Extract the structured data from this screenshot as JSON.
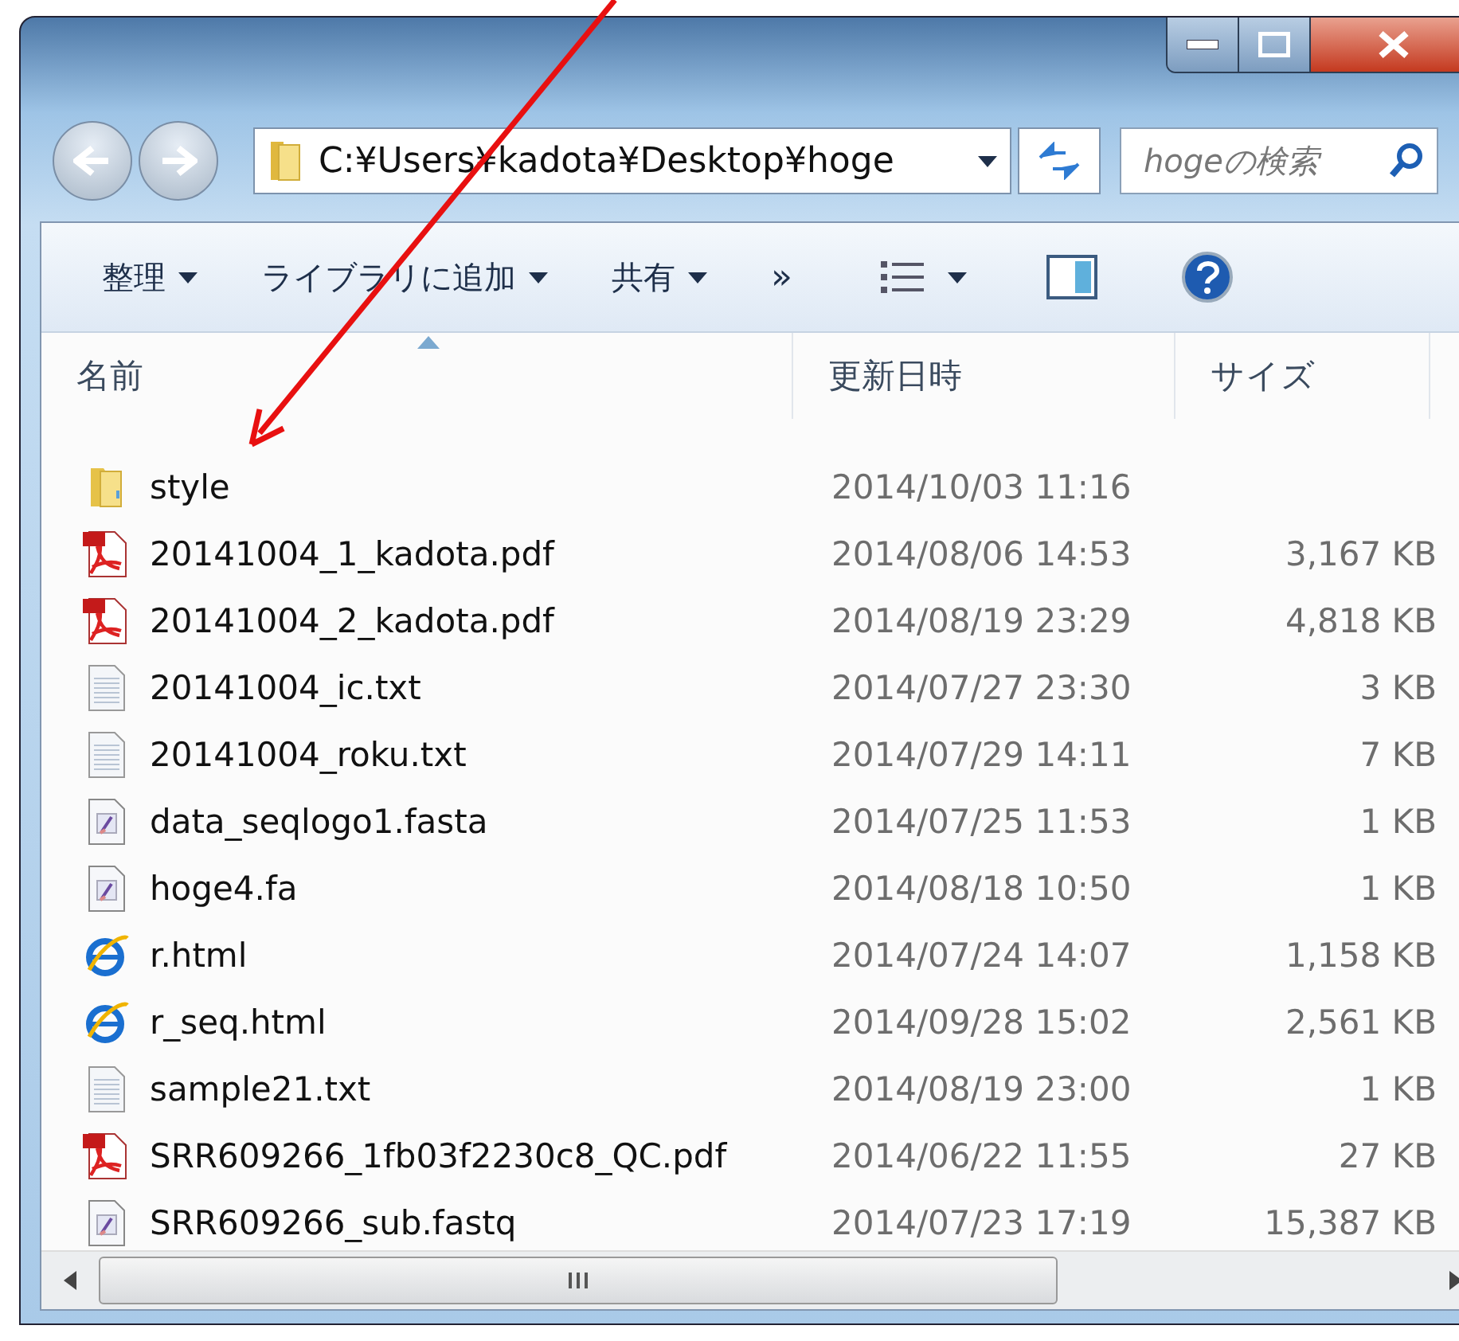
{
  "address_bar": {
    "path": "C:¥Users¥kadota¥Desktop¥hoge"
  },
  "search": {
    "placeholder": "hogeの検索"
  },
  "toolbar": {
    "items": [
      {
        "kind": "menu",
        "label": "整理"
      },
      {
        "kind": "menu",
        "label": "ライブラリに追加"
      },
      {
        "kind": "menu",
        "label": "共有"
      },
      {
        "kind": "more",
        "label": "»"
      },
      {
        "kind": "views"
      },
      {
        "kind": "pane"
      },
      {
        "kind": "help"
      }
    ]
  },
  "columns": [
    {
      "label": "名前",
      "sorted": true
    },
    {
      "label": "更新日時",
      "sorted": false
    },
    {
      "label": "サイズ",
      "sorted": false
    }
  ],
  "files": [
    {
      "kind": "folder",
      "name": "style",
      "modified": "2014/10/03 11:16"
    },
    {
      "kind": "pdf",
      "name": "20141004_1_kadota.pdf",
      "modified": "2014/08/06 14:53",
      "size": "3,167 KB"
    },
    {
      "kind": "pdf",
      "name": "20141004_2_kadota.pdf",
      "modified": "2014/08/19 23:29",
      "size": "4,818 KB"
    },
    {
      "kind": "text",
      "name": "20141004_ic.txt",
      "modified": "2014/07/27 23:30",
      "size": "3 KB"
    },
    {
      "kind": "text",
      "name": "20141004_roku.txt",
      "modified": "2014/07/29 14:11",
      "size": "7 KB"
    },
    {
      "kind": "generic",
      "name": "data_seqlogo1.fasta",
      "modified": "2014/07/25 11:53",
      "size": "1 KB"
    },
    {
      "kind": "generic",
      "name": "hoge4.fa",
      "modified": "2014/08/18 10:50",
      "size": "1 KB"
    },
    {
      "kind": "html",
      "name": "r.html",
      "modified": "2014/07/24 14:07",
      "size": "1,158 KB"
    },
    {
      "kind": "html",
      "name": "r_seq.html",
      "modified": "2014/09/28 15:02",
      "size": "2,561 KB"
    },
    {
      "kind": "text",
      "name": "sample21.txt",
      "modified": "2014/08/19 23:00",
      "size": "1 KB"
    },
    {
      "kind": "pdf",
      "name": "SRR609266_1fb03f2230c8_QC.pdf",
      "modified": "2014/06/22 11:55",
      "size": "27 KB"
    },
    {
      "kind": "generic",
      "name": "SRR609266_sub.fastq",
      "modified": "2014/07/23 17:19",
      "size": "15,387 KB"
    }
  ],
  "annotation": {
    "kind": "arrow"
  }
}
